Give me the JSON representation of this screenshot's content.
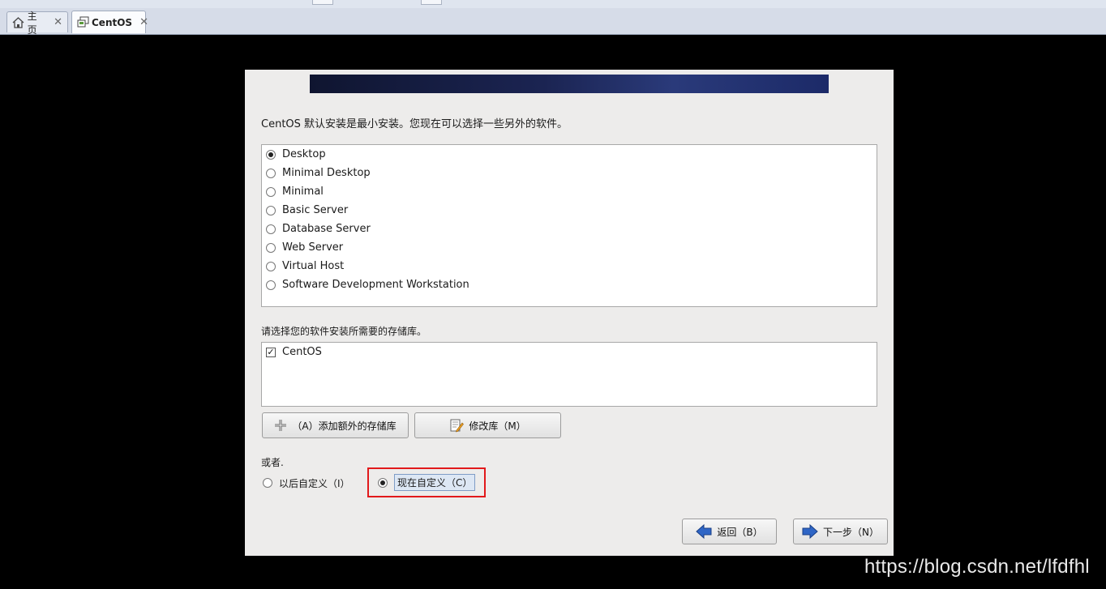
{
  "tabs": [
    {
      "label": "主页",
      "icon": "home-icon",
      "close": "✕"
    },
    {
      "label": "CentOS",
      "icon": "vm-icon",
      "close": "✕"
    }
  ],
  "installer": {
    "intro": "CentOS 默认安装是最小安装。您现在可以选择一些另外的软件。",
    "profiles": [
      {
        "label": "Desktop",
        "selected": true
      },
      {
        "label": "Minimal Desktop",
        "selected": false
      },
      {
        "label": "Minimal",
        "selected": false
      },
      {
        "label": "Basic Server",
        "selected": false
      },
      {
        "label": "Database Server",
        "selected": false
      },
      {
        "label": "Web Server",
        "selected": false
      },
      {
        "label": "Virtual Host",
        "selected": false
      },
      {
        "label": "Software Development Workstation",
        "selected": false
      }
    ],
    "repo_label": "请选择您的软件安装所需要的存储库。",
    "repos": [
      {
        "label": "CentOS",
        "checked": true
      }
    ],
    "check_mark": "✓",
    "add_repo_button": "（A）添加额外的存储库",
    "modify_repo_button": "修改库（M）",
    "or_label": "或者.",
    "customize_later": "以后自定义（I）",
    "customize_now": "现在自定义（C）",
    "back_button": "返回（B）",
    "next_button": "下一步（N）"
  },
  "watermark": "https://blog.csdn.net/lfdfhl",
  "colors": {
    "highlight_outline": "#e2191b",
    "arrow_blue": "#2f66c6",
    "banner": "#1b2452"
  }
}
